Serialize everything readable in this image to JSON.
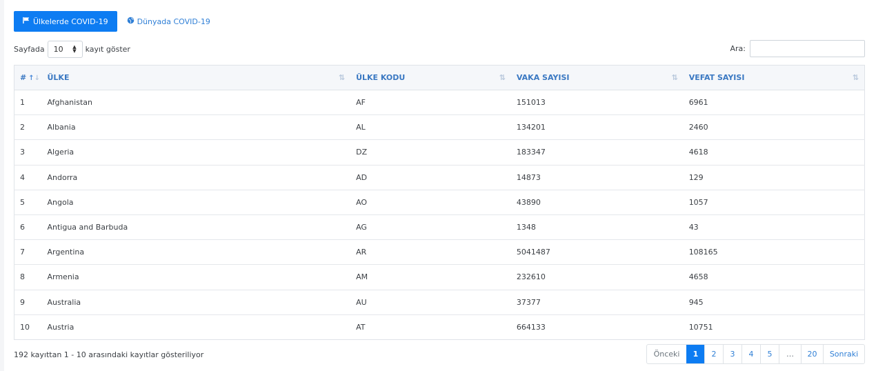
{
  "tabs": {
    "active_label": "Ülkelerde COVID-19",
    "link_label": "Dünyada COVID-19"
  },
  "length_control": {
    "prefix": "Sayfada",
    "value": "10",
    "suffix": "kayıt göster"
  },
  "search": {
    "label": "Ara:"
  },
  "table": {
    "headers": [
      "#",
      "ÜLKE",
      "ÜLKE KODU",
      "VAKA SAYISI",
      "VEFAT SAYISI"
    ],
    "rows": [
      [
        "1",
        "Afghanistan",
        "AF",
        "151013",
        "6961"
      ],
      [
        "2",
        "Albania",
        "AL",
        "134201",
        "2460"
      ],
      [
        "3",
        "Algeria",
        "DZ",
        "183347",
        "4618"
      ],
      [
        "4",
        "Andorra",
        "AD",
        "14873",
        "129"
      ],
      [
        "5",
        "Angola",
        "AO",
        "43890",
        "1057"
      ],
      [
        "6",
        "Antigua and Barbuda",
        "AG",
        "1348",
        "43"
      ],
      [
        "7",
        "Argentina",
        "AR",
        "5041487",
        "108165"
      ],
      [
        "8",
        "Armenia",
        "AM",
        "232610",
        "4658"
      ],
      [
        "9",
        "Australia",
        "AU",
        "37377",
        "945"
      ],
      [
        "10",
        "Austria",
        "AT",
        "664133",
        "10751"
      ]
    ]
  },
  "footer": {
    "info": "192 kayıttan 1 - 10 arasındaki kayıtlar gösteriliyor"
  },
  "pagination": {
    "prev": "Önceki",
    "pages": [
      "1",
      "2",
      "3",
      "4",
      "5",
      "…",
      "20"
    ],
    "next": "Sonraki"
  },
  "colors": {
    "accent": "#0d7cf2",
    "link": "#2f7fd6",
    "header_text": "#3a78c2"
  },
  "icons": {
    "flag": "flag-icon",
    "globe": "globe-icon",
    "sort": "sort-icon",
    "sort_asc": "sort-asc-icon"
  }
}
